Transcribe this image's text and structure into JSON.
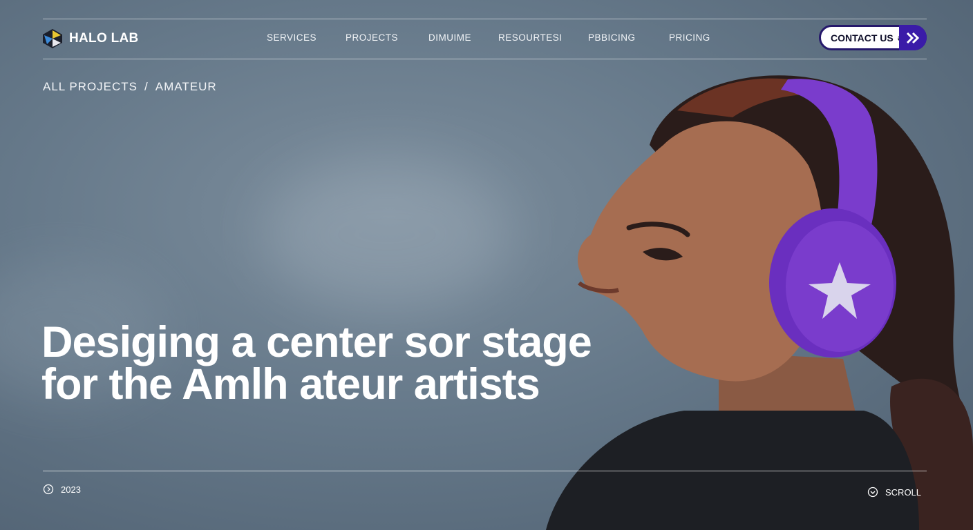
{
  "brand": {
    "name": "HALO LAB"
  },
  "nav": {
    "items": [
      {
        "label": "SERVICES"
      },
      {
        "label": "PROJECTS"
      },
      {
        "label": "DIMUIME"
      },
      {
        "label": "RESOURTESI"
      },
      {
        "label": "PBBICING"
      },
      {
        "label": "PRICING"
      }
    ]
  },
  "contact": {
    "label": "CONTACT US",
    "suffix": "ə"
  },
  "breadcrumb": {
    "root": "ALL PROJECTS",
    "separator": "/",
    "current": "AMATEUR"
  },
  "hero": {
    "line1": "Desiging a center sor stage",
    "line2": "for the Amlh ateur artists"
  },
  "footer": {
    "year": "2023",
    "scroll": "SCROLL"
  },
  "colors": {
    "accent": "#3a1ba8",
    "headphones": "#7a3ccc",
    "sky": "#66798a"
  }
}
